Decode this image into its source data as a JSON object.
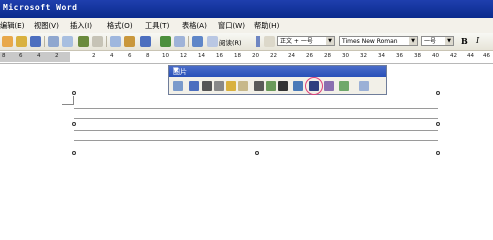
{
  "window": {
    "title": "Microsoft Word"
  },
  "menubar": {
    "items": [
      "编辑(E)",
      "视图(V)",
      "插入(I)",
      "格式(O)",
      "工具(T)",
      "表格(A)",
      "窗口(W)",
      "帮助(H)"
    ]
  },
  "toolbar": {
    "reading_label": "阅读(R)",
    "style_value": "正文 + 一号",
    "font_value": "Times New Roman",
    "size_value": "一号",
    "bold_label": "B",
    "italic_label": "I"
  },
  "ruler": {
    "marks": [
      "8",
      "6",
      "4",
      "2",
      "2",
      "4",
      "6",
      "8",
      "10",
      "12",
      "14",
      "16",
      "18",
      "20",
      "22",
      "24",
      "26",
      "28",
      "30",
      "32",
      "34",
      "36",
      "38",
      "40",
      "42",
      "44",
      "46"
    ]
  },
  "picture_toolbar": {
    "title": "图片",
    "highlighted_tool": "text-wrapping",
    "highlight_color": "#e0407a"
  },
  "colors": {
    "titlebar": "#0a2a8c",
    "menubar": "#f3f1ea"
  }
}
